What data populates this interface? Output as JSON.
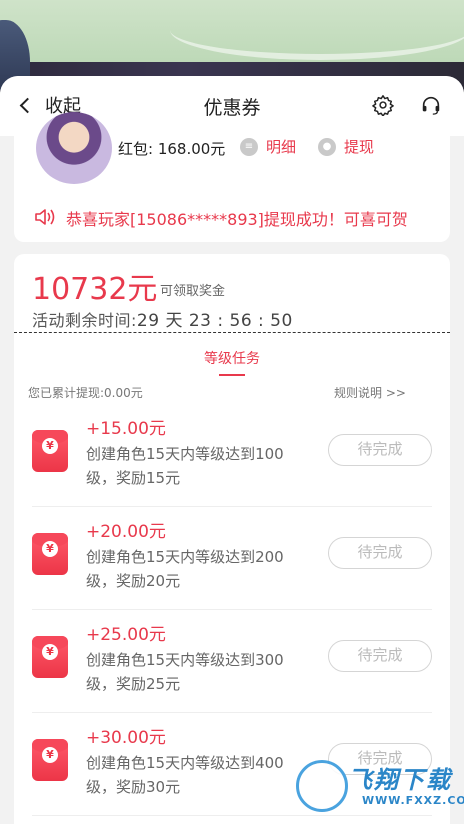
{
  "header": {
    "back_label": "收起",
    "title": "优惠券"
  },
  "user": {
    "redpack_label": "红包: 168.00元",
    "detail_label": "明细",
    "withdraw_label": "提现"
  },
  "notice": {
    "text": "恭喜玩家[15086*****893]提现成功！可喜可贺"
  },
  "reward": {
    "amount": "10732元",
    "amount_caption": "可领取奖金",
    "countdown_label": "活动剩余时间:",
    "countdown_value": "29 天 23 : 56 : 50"
  },
  "tasks_section": {
    "title": "等级任务",
    "cumulative": "您已累计提现:0.00元",
    "rules": "规则说明 >>",
    "items": [
      {
        "reward": "+15.00元",
        "desc": "创建角色15天内等级达到100级，奖励15元",
        "button": "待完成"
      },
      {
        "reward": "+20.00元",
        "desc": "创建角色15天内等级达到200级，奖励20元",
        "button": "待完成"
      },
      {
        "reward": "+25.00元",
        "desc": "创建角色15天内等级达到300级，奖励25元",
        "button": "待完成"
      },
      {
        "reward": "+30.00元",
        "desc": "创建角色15天内等级达到400级，奖励30元",
        "button": "待完成"
      }
    ]
  },
  "watermark": {
    "brand": "飞翔下载",
    "url": "WWW.FXXZ.COM"
  },
  "colors": {
    "accent": "#e8394c",
    "background": "#f2f2f2"
  },
  "icons": {
    "back": "chevron-left-icon",
    "settings": "gear-icon",
    "support": "headset-icon",
    "detail": "document-icon",
    "withdraw": "chat-icon",
    "notice": "speaker-icon",
    "task": "red-envelope-icon"
  }
}
